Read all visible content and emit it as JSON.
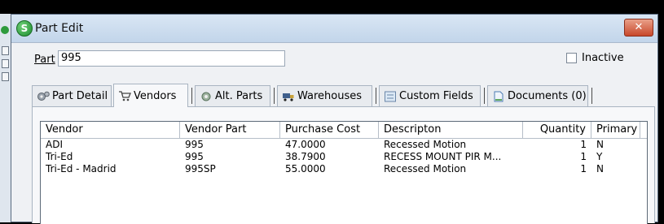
{
  "window": {
    "title": "Part Edit",
    "close_glyph": "✕",
    "app_icon_letter": "S"
  },
  "form": {
    "part_label": "Part",
    "part_value": "995",
    "inactive_label": "Inactive",
    "inactive_checked": false
  },
  "tabs": [
    {
      "label": "Part Detail",
      "icon": "gears-icon"
    },
    {
      "label": "Vendors",
      "icon": "cart-icon",
      "active": true
    },
    {
      "label": "Alt. Parts",
      "icon": "gear-icon"
    },
    {
      "label": "Warehouses",
      "icon": "truck-icon"
    },
    {
      "label": "Custom Fields",
      "icon": "form-icon"
    },
    {
      "label": "Documents (0)",
      "icon": "document-icon"
    }
  ],
  "vendors_table": {
    "columns": [
      "Vendor",
      "Vendor Part",
      "Purchase Cost",
      "Descripton",
      "Quantity",
      "Primary"
    ],
    "rows": [
      [
        "ADI",
        "995",
        "47.0000",
        "Recessed Motion",
        "1",
        "N"
      ],
      [
        "Tri-Ed",
        "995",
        "38.7900",
        "RECESS MOUNT PIR M...",
        "1",
        "Y"
      ],
      [
        "Tri-Ed - Madrid",
        "995SP",
        "55.0000",
        "Recessed Motion",
        "1",
        "N"
      ]
    ]
  },
  "colors": {
    "close_button": "#c8482b",
    "titlebar": "#cfdff0",
    "app_icon": "#2f9b3c"
  }
}
